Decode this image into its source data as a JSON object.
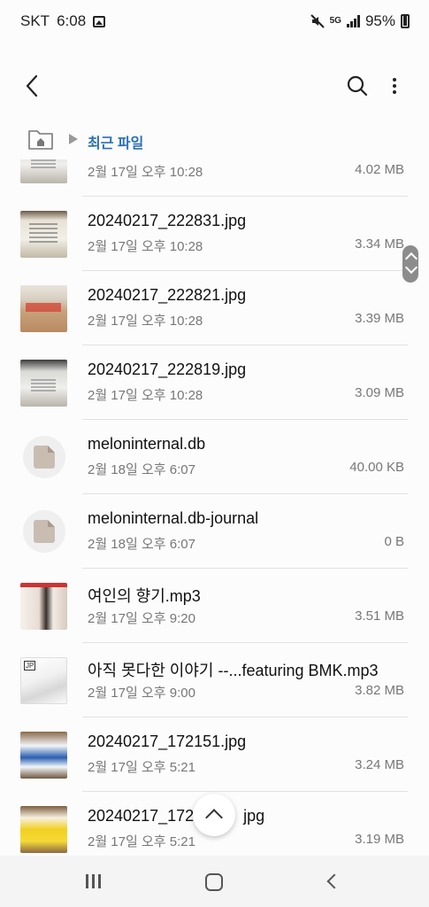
{
  "status_bar": {
    "carrier": "SKT",
    "time": "6:08",
    "network": "5G",
    "battery": "95%"
  },
  "app_bar": {
    "back_icon": "arrow-back-icon",
    "search_icon": "search-icon",
    "more_icon": "more-vert-icon"
  },
  "breadcrumb": {
    "home_icon": "home-folder-icon",
    "current": "최근 파일",
    "accent": "#2b6fb8"
  },
  "files": [
    {
      "name": "",
      "date": "2월 17일 오후 10:28",
      "size": "4.02 MB",
      "thumb": "t-pack2"
    },
    {
      "name": "20240217_222831.jpg",
      "date": "2월 17일 오후 10:28",
      "size": "3.34 MB",
      "thumb": "t-receipt"
    },
    {
      "name": "20240217_222821.jpg",
      "date": "2월 17일 오후 10:28",
      "size": "3.39 MB",
      "thumb": "t-pack1"
    },
    {
      "name": "20240217_222819.jpg",
      "date": "2월 17일 오후 10:28",
      "size": "3.09 MB",
      "thumb": "t-pack2"
    },
    {
      "name": "meloninternal.db",
      "date": "2월 18일 오후 6:07",
      "size": "40.00 KB",
      "thumb": "document-icon"
    },
    {
      "name": "meloninternal.db-journal",
      "date": "2월 18일 오후 6:07",
      "size": "0 B",
      "thumb": "document-icon"
    },
    {
      "name": "여인의 향기.mp3",
      "date": "2월 17일 오후 9:20",
      "size": "3.51 MB",
      "thumb": "t-album"
    },
    {
      "name": "아직 못다한 이야기 --...featuring BMK.mp3",
      "date": "2월 17일 오후 9:00",
      "size": "3.82 MB",
      "thumb": "t-album2"
    },
    {
      "name": "20240217_172151.jpg",
      "date": "2월 17일 오후 5:21",
      "size": "3.24 MB",
      "thumb": "t-milk1"
    },
    {
      "name": "20240217_172",
      "name_tail": "jpg",
      "date": "2월 17일 오후 5:21",
      "size": "3.19 MB",
      "thumb": "t-milk2"
    }
  ],
  "fab": {
    "icon": "chevron-up-icon"
  },
  "nav_bar": {
    "recents_icon": "recents-icon",
    "home_icon": "home-icon",
    "back_icon": "back-icon"
  }
}
